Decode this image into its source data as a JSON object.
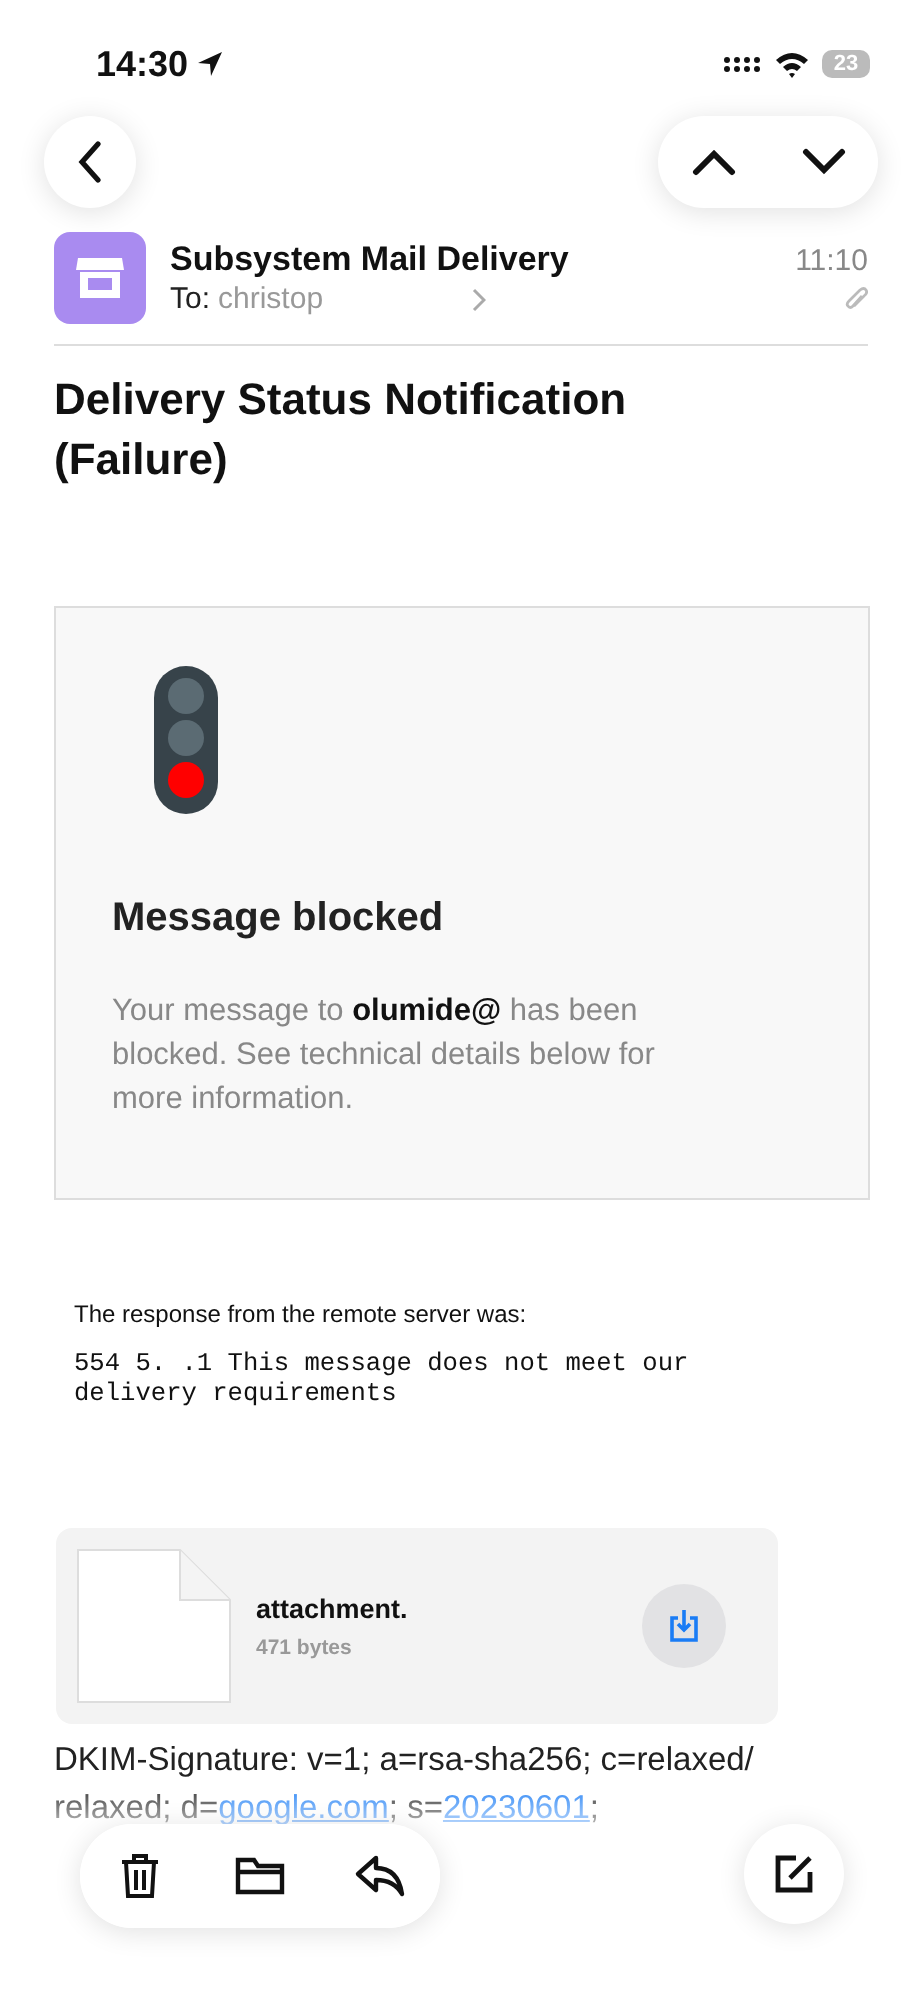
{
  "status_bar": {
    "time": "14:30",
    "battery": "23"
  },
  "message": {
    "sender": "Subsystem Mail Delivery",
    "to_label": "To:",
    "to": "christop",
    "time": "11:10",
    "has_attachment": true
  },
  "subject": "Delivery Status Notification (Failure)",
  "notice": {
    "title": "Message blocked",
    "text": "Your message to **olumide@** has been blocked. See technical details below for more information."
  },
  "response": {
    "intro": "The response from the remote server was:",
    "code": "554 5. .1 This message does not meet our delivery requirements"
  },
  "attachment": {
    "name": "attachment.",
    "size": "471 bytes"
  },
  "body": [
    {
      "kind": "text",
      "text": "DKIM-Signature: v=1; a=rsa-sha256; c=relaxed/ relaxed; d="
    },
    {
      "kind": "link",
      "text": "google.com"
    },
    {
      "kind": "text",
      "text": "; s="
    },
    {
      "kind": "link",
      "text": "20230601"
    },
    {
      "kind": "text",
      "text": ";"
    }
  ]
}
